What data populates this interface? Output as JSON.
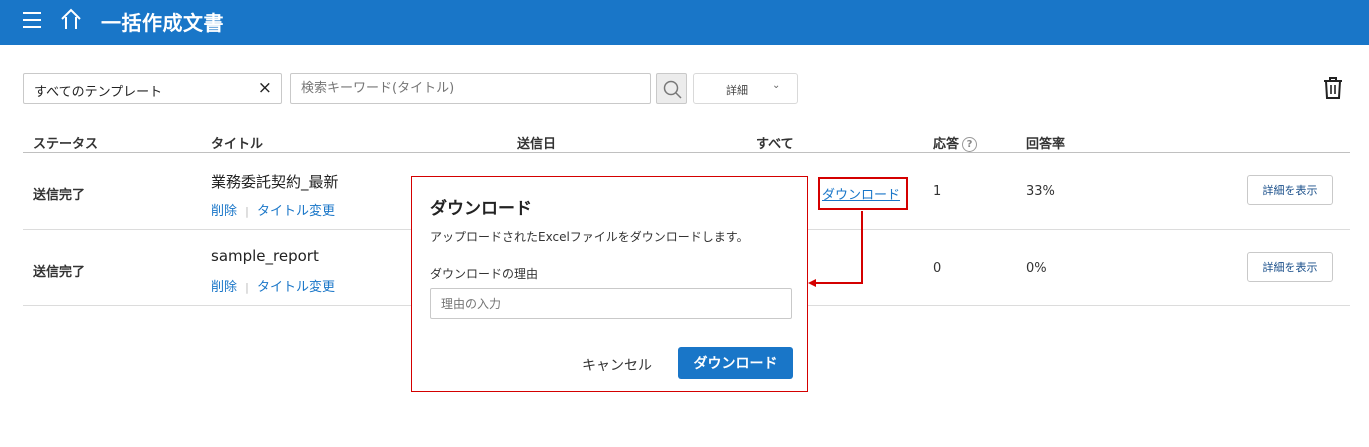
{
  "header": {
    "title": "一括作成文書"
  },
  "toolbar": {
    "template_filter": "すべてのテンプレート",
    "clear_symbol": "×",
    "search_placeholder": "検索キーワード(タイトル)",
    "details_label": "詳細",
    "details_chevron": "⌄"
  },
  "table": {
    "headers": {
      "status": "ステータス",
      "title": "タイトル",
      "sent_date": "送信日",
      "all": "すべて",
      "response": "応答",
      "help": "?",
      "response_rate": "回答率"
    },
    "rows": [
      {
        "status": "送信完了",
        "title": "業務委託契約_最新",
        "delete": "削除",
        "sep": "|",
        "rename": "タイトル変更",
        "download": "ダウンロード",
        "responses": "1",
        "rate": "33%",
        "detail": "詳細を表示"
      },
      {
        "status": "送信完了",
        "title": "sample_report",
        "delete": "削除",
        "sep": "|",
        "rename": "タイトル変更",
        "responses": "0",
        "rate": "0%",
        "detail": "詳細を表示"
      }
    ]
  },
  "dialog": {
    "title": "ダウンロード",
    "description": "アップロードされたExcelファイルをダウンロードします。",
    "reason_label": "ダウンロードの理由",
    "reason_placeholder": "理由の入力",
    "cancel": "キャンセル",
    "confirm": "ダウンロード"
  },
  "colors": {
    "primary": "#1976c8",
    "highlight": "#d40000"
  }
}
